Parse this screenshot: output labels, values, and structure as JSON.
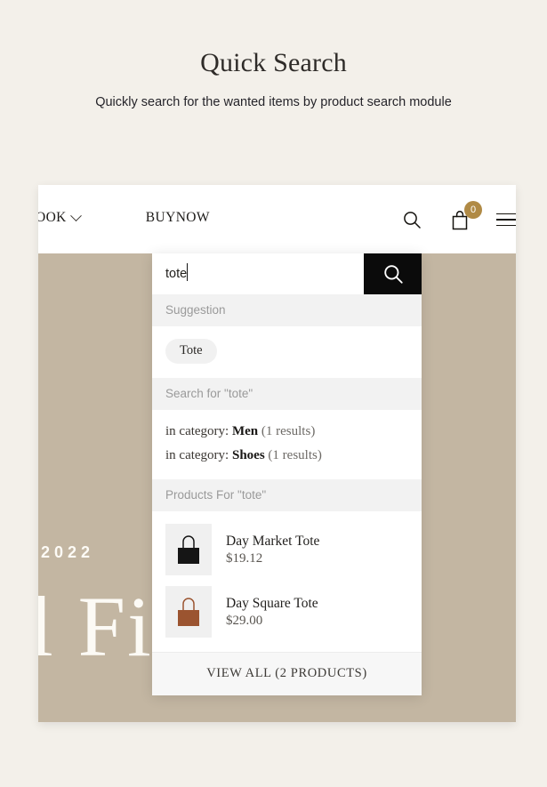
{
  "page": {
    "title": "Quick Search",
    "subtitle": "Quickly search for the wanted items by product search module",
    "background_color": "#f3f0ea"
  },
  "site_header": {
    "nav_items": [
      {
        "label": "OOK",
        "icon": "chevron-down-icon",
        "has_chevron": true
      },
      {
        "label": "BUYNOW",
        "has_chevron": false
      }
    ],
    "icons": {
      "search": "search-icon",
      "bag": "shopping-bag-icon",
      "menu": "hamburger-menu-icon"
    },
    "cart_count": "0",
    "cart_badge_color": "#b08a45"
  },
  "hero": {
    "year": "2022",
    "headline": "l Fi",
    "background_color": "#c3b6a2"
  },
  "search": {
    "value": "tote",
    "placeholder": "Search products...",
    "button_icon": "search-icon",
    "button_color": "#0b0b0b",
    "suggestion_header": "Suggestion",
    "suggestion_tags": [
      "Tote"
    ],
    "search_for_header": "Search for \"tote\"",
    "categories": [
      {
        "prefix": "in category:",
        "name": "Men",
        "count": "(1 results)"
      },
      {
        "prefix": "in category:",
        "name": "Shoes",
        "count": "(1 results)"
      }
    ],
    "products_header": "Products For \"tote\"",
    "products": [
      {
        "name": "Day Market Tote",
        "price": "$19.12",
        "thumb_icon": "tote-bag-icon",
        "color": "#151515"
      },
      {
        "name": "Day Square Tote",
        "price": "$29.00",
        "thumb_icon": "tote-bag-icon",
        "color": "#9b5430"
      }
    ],
    "view_all": "VIEW ALL (2 PRODUCTS)"
  }
}
